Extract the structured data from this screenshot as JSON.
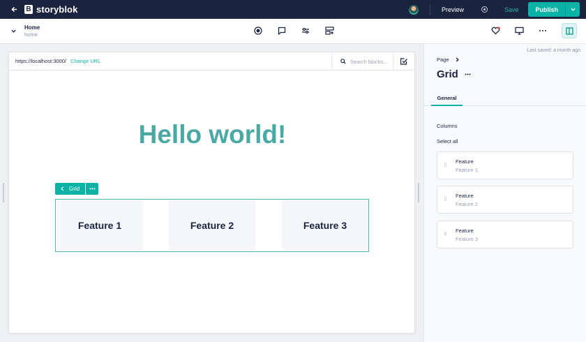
{
  "topbar": {
    "brand": "storyblok",
    "logo_letter": "B",
    "preview_label": "Preview",
    "save_label": "Save",
    "publish_label": "Publish"
  },
  "toolbar": {
    "story_title": "Home",
    "story_slug": "home"
  },
  "preview": {
    "url": "https://localhost:3000/",
    "change_url_label": "Change URL",
    "search_placeholder": "Search blocks...",
    "headline": "Hello world!",
    "grid_tag_label": "Grid",
    "features": [
      "Feature 1",
      "Feature 2",
      "Feature 3"
    ]
  },
  "panel": {
    "last_saved": "Last saved: a month ago",
    "breadcrumb": "Page",
    "title": "Grid",
    "tab_general": "General",
    "columns_label": "Columns",
    "select_all_label": "Select all",
    "items": [
      {
        "title": "Feature",
        "subtitle": "Feature 1"
      },
      {
        "title": "Feature",
        "subtitle": "Feature 2"
      },
      {
        "title": "Feature",
        "subtitle": "Feature 3"
      }
    ]
  },
  "colors": {
    "navbar": "#1b243f",
    "accent": "#0ab3a5",
    "headline": "#4aa9a4"
  },
  "icons": [
    "arrow-left-icon",
    "record-icon",
    "comment-icon",
    "sliders-icon",
    "blocks-icon",
    "heart-icon",
    "desktop-icon",
    "more-icon",
    "panel-icon",
    "search-icon",
    "checkbox-icon",
    "drag-handle-icon"
  ]
}
